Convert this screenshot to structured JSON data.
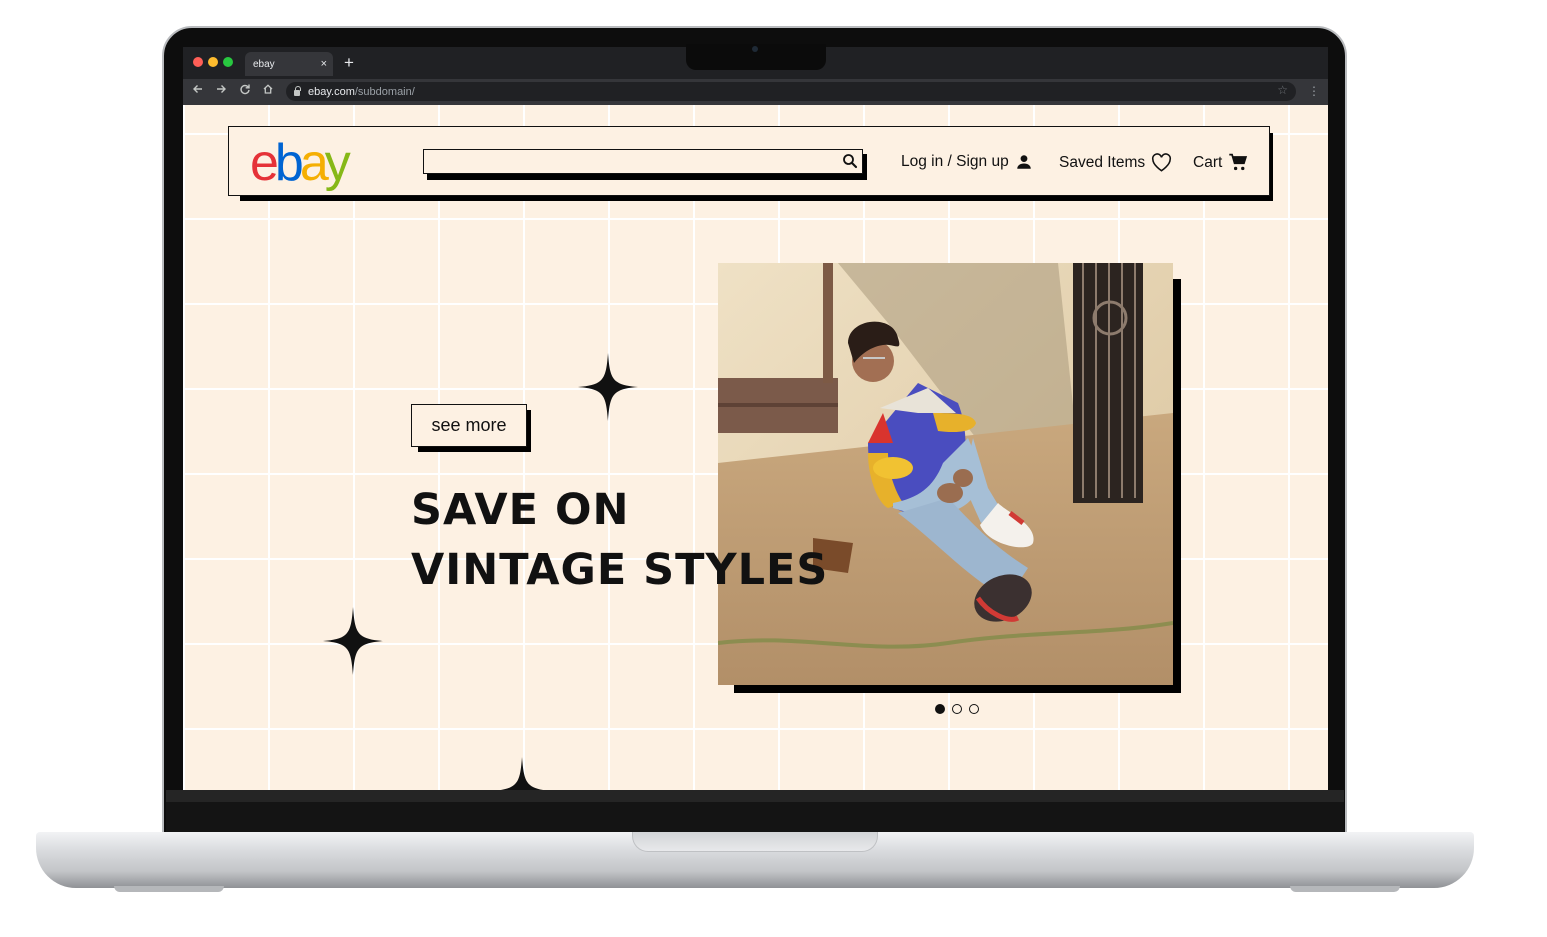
{
  "browser": {
    "tab_title": "ebay",
    "tab_close": "×",
    "new_tab": "+",
    "url_host": "ebay.com",
    "url_path": "/subdomain/"
  },
  "header": {
    "logo_letters": [
      "e",
      "b",
      "a",
      "y"
    ],
    "logo_colors": [
      "#e53238",
      "#0064d2",
      "#f5af02",
      "#86b817"
    ],
    "search_placeholder": "",
    "login_label": "Log in / Sign up",
    "saved_label": "Saved Items",
    "cart_label": "Cart"
  },
  "hero": {
    "see_more": "see more",
    "headline_line1": "SAVE ON",
    "headline_line2": "VINTAGE STYLES",
    "carousel": {
      "slides": 3,
      "active": 1
    }
  },
  "icons": {
    "search": "search-icon",
    "user": "user-icon",
    "heart": "heart-icon",
    "cart": "cart-icon",
    "sparkle": "sparkle-icon"
  },
  "colors": {
    "page_bg": "#fdf1e3",
    "ink": "#111111",
    "grid_line": "#ffffff"
  }
}
